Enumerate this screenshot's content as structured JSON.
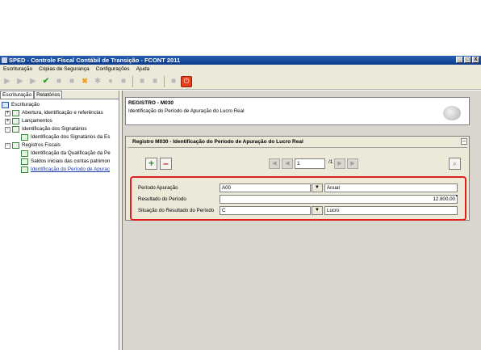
{
  "window": {
    "title": "SPED - Controle Fiscal Contábil de Transição - FCONT 2011",
    "controls": [
      "_",
      "□",
      "X"
    ]
  },
  "menu": {
    "items": [
      "Escrituração",
      "Cópias de Segurança",
      "Configurações",
      "Ajuda"
    ]
  },
  "left_panel": {
    "tabs": [
      "Escrituração",
      "Relatórios"
    ],
    "tree": [
      {
        "label": "Escrituração",
        "level": 0,
        "expander": "",
        "icon": "root"
      },
      {
        "label": "Abertura, identificação e referências",
        "level": 1,
        "expander": "+",
        "icon": "doc"
      },
      {
        "label": "Lançamentos",
        "level": 1,
        "expander": "+",
        "icon": "doc"
      },
      {
        "label": "Identificação dos Signatários",
        "level": 1,
        "expander": "-",
        "icon": "doc"
      },
      {
        "label": "Identificação dos Signatários da Es",
        "level": 2,
        "expander": "",
        "icon": "doc"
      },
      {
        "label": "Registros Fiscais",
        "level": 1,
        "expander": "-",
        "icon": "doc"
      },
      {
        "label": "Identificação da Qualificação da Pe",
        "level": 2,
        "expander": "",
        "icon": "doc"
      },
      {
        "label": "Saldos iniciais das contas patrimon",
        "level": 2,
        "expander": "",
        "icon": "doc"
      },
      {
        "label": "Identificação do Período de Apuraç",
        "level": 2,
        "expander": "",
        "icon": "doc",
        "selected": true
      }
    ]
  },
  "register": {
    "title": "REGISTRO - M030",
    "description": "Identificação do Período de Apuração do Lucro Real"
  },
  "panel": {
    "title": "Registro M030 - Identificação do Período de Apuração do Lucro Real",
    "page_value": "1",
    "page_of": "/1"
  },
  "form": {
    "periodo_label": "Período Apuração",
    "periodo_code": "A00",
    "periodo_desc": "Anual",
    "resultado_label": "Resultado do Período",
    "resultado_value": "12.800,00",
    "situacao_label": "Situação do Resultado do Período",
    "situacao_code": "C",
    "situacao_desc": "Lucro"
  }
}
